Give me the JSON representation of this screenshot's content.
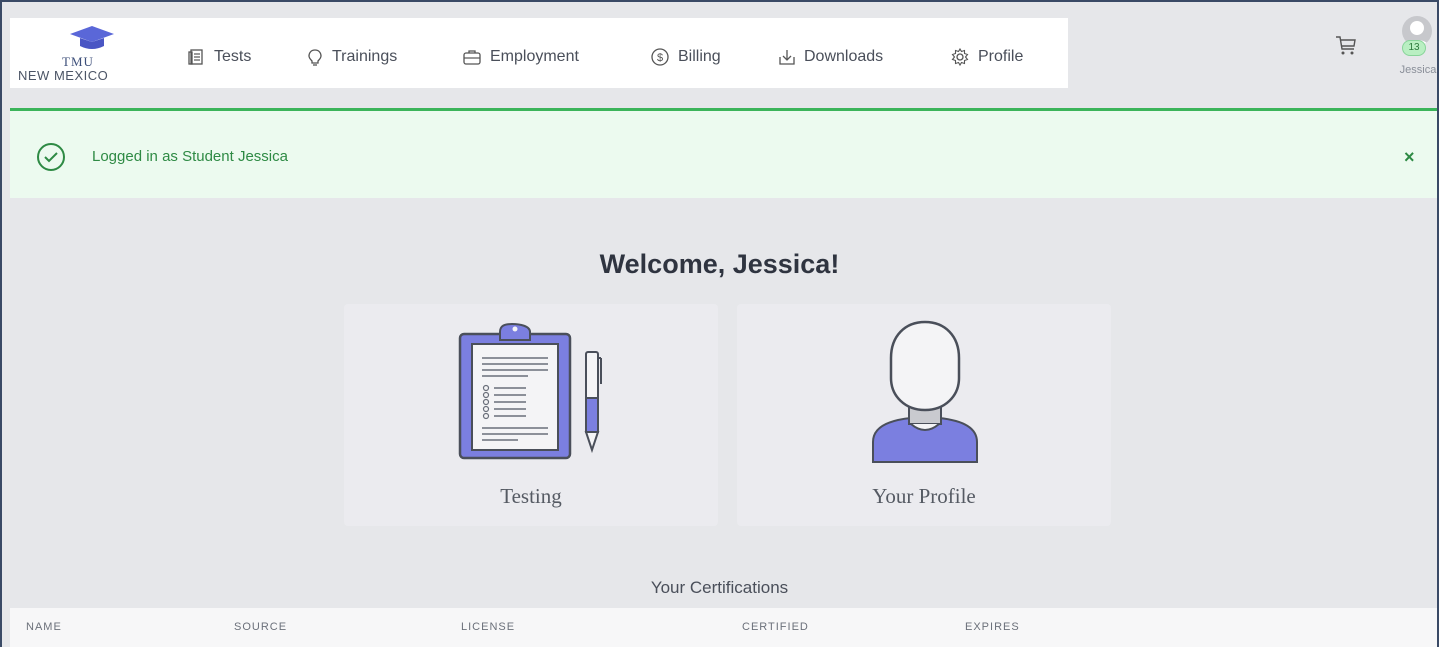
{
  "brand": {
    "line1": "TMU",
    "line2": "NEW MEXICO"
  },
  "nav": {
    "items": [
      {
        "label": "Tests",
        "icon": "document-icon"
      },
      {
        "label": "Trainings",
        "icon": "lightbulb-icon"
      },
      {
        "label": "Employment",
        "icon": "briefcase-icon"
      },
      {
        "label": "Billing",
        "icon": "dollar-icon"
      },
      {
        "label": "Downloads",
        "icon": "download-icon"
      },
      {
        "label": "Profile",
        "icon": "gear-icon"
      }
    ]
  },
  "user": {
    "badge": "13",
    "name": "Jessica"
  },
  "alert": {
    "message": "Logged in as Student Jessica",
    "close": "×"
  },
  "main": {
    "welcome": "Welcome, Jessica!",
    "cards": [
      {
        "label": "Testing",
        "icon": "clipboard-icon"
      },
      {
        "label": "Your Profile",
        "icon": "person-icon"
      }
    ]
  },
  "certifications": {
    "title": "Your Certifications",
    "columns": [
      "NAME",
      "SOURCE",
      "LICENSE",
      "CERTIFIED",
      "EXPIRES"
    ]
  },
  "colors": {
    "accent": "#7b7fe0",
    "success": "#3bb45a",
    "alert_bg": "#ecfaef",
    "page_bg": "#e6e7ea"
  }
}
